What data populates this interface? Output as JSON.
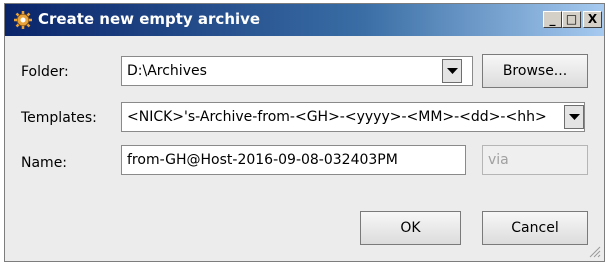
{
  "window": {
    "title": "Create new empty archive",
    "icon": "archive-gear-icon",
    "controls": {
      "minimize": "_",
      "maximize": "□",
      "close": "X"
    }
  },
  "form": {
    "folder_label": "Folder:",
    "folder_value": "D:\\Archives",
    "browse_label": "Browse...",
    "templates_label": "Templates:",
    "templates_value": "<NICK>'s-Archive-from-<GH>-<yyyy>-<MM>-<dd>-<hh>",
    "name_label": "Name:",
    "name_value": "from-GH@Host-2016-09-08-032403PM",
    "via_value": "via"
  },
  "buttons": {
    "ok": "OK",
    "cancel": "Cancel"
  },
  "colors": {
    "title_start": "#0a246a",
    "title_end": "#a6caf0",
    "dialog_bg": "#ececec"
  }
}
